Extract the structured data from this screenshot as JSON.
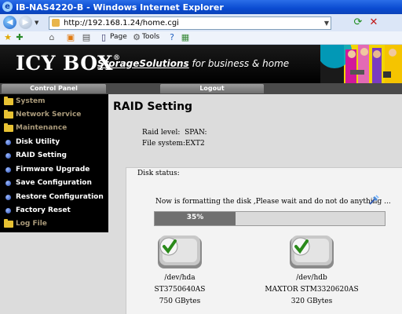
{
  "browser": {
    "window_title": "IB-NAS4220-B - Windows Internet Explorer",
    "address_url": "http://192.168.1.24/home.cgi",
    "command_bar": {
      "page_label": "Page",
      "tools_label": "Tools"
    }
  },
  "banner": {
    "logo_text": "ICY BOX",
    "logo_reg": "®",
    "tagline_strong": "StorageSolutions",
    "tagline_rest": " for business & home"
  },
  "tabs": {
    "control_panel": "Control Panel",
    "logout": "Logout"
  },
  "sidebar": {
    "items": [
      {
        "label": "System",
        "type": "folder"
      },
      {
        "label": "Network Service",
        "type": "folder"
      },
      {
        "label": "Maintenance",
        "type": "folder"
      },
      {
        "label": "Disk Utility",
        "type": "link"
      },
      {
        "label": "RAID Setting",
        "type": "link"
      },
      {
        "label": "Firmware Upgrade",
        "type": "link"
      },
      {
        "label": "Save Configuration",
        "type": "link"
      },
      {
        "label": "Restore Configuration",
        "type": "link"
      },
      {
        "label": "Factory Reset",
        "type": "link"
      },
      {
        "label": "Log File",
        "type": "folder"
      }
    ]
  },
  "main": {
    "title": "RAID Setting",
    "raid_level_label": "Raid level:",
    "raid_level_value": "SPAN:",
    "file_system_label": "File system:",
    "file_system_value": "EXT2",
    "disk_status_label": "Disk status:",
    "format_message": "Now is formatting the disk ,Please wait and do not do anything ...",
    "progress_label": "35%",
    "progress_fraction": 0.35,
    "disks": [
      {
        "device": "/dev/hda",
        "model": "ST3750640AS",
        "size": "750 GBytes"
      },
      {
        "device": "/dev/hdb",
        "model": "MAXTOR STM3320620AS",
        "size": "320 GBytes"
      }
    ]
  },
  "colors": {
    "titlebar": "#0a4bd1",
    "sidebar_bg": "#000000",
    "page_bg": "#dcdcdc",
    "progress_fill": "#707070",
    "folder_icon": "#e8c233"
  }
}
